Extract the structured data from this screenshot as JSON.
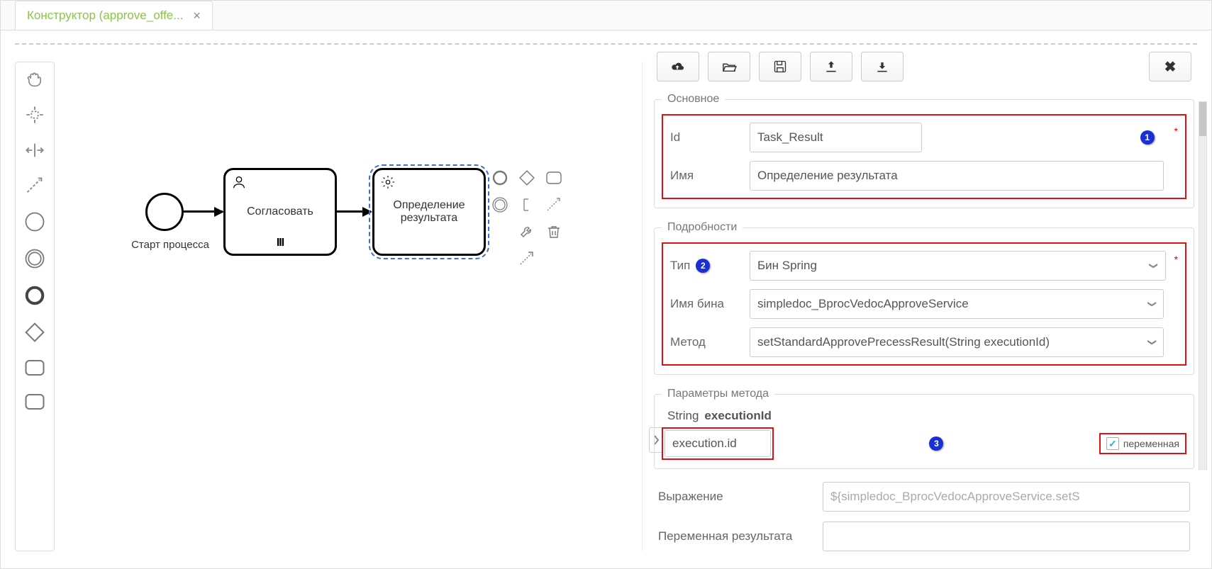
{
  "tab": {
    "title": "Конструктор (approve_offe...",
    "close_glyph": "×"
  },
  "palette": {
    "tools": [
      "hand",
      "lasso",
      "space",
      "connect",
      "start-event",
      "intermediate-event",
      "end-event",
      "gateway",
      "task",
      "sub-process"
    ]
  },
  "canvas": {
    "start_label": "Старт процесса",
    "user_task_label": "Согласовать",
    "service_task_line1": "Определение",
    "service_task_line2": "результата"
  },
  "toolbar": {
    "buttons": [
      "cloud-upload",
      "open",
      "save",
      "export",
      "import"
    ],
    "close": "✕"
  },
  "panel": {
    "section_main": "Основное",
    "section_details": "Подробности",
    "section_params": "Параметры метода",
    "id_label": "Id",
    "id_value": "Task_Result",
    "name_label": "Имя",
    "name_value": "Определение результата",
    "type_label": "Тип",
    "type_value": "Бин Spring",
    "bean_label": "Имя бина",
    "bean_value": "simpledoc_BprocVedocApproveService",
    "method_label": "Метод",
    "method_value": "setStandardApprovePrecessResult(String executionId)",
    "param_type": "String",
    "param_name": "executionId",
    "param_value": "execution.id",
    "param_checkbox_label": "переменная",
    "expression_label": "Выражение",
    "expression_value": "${simpledoc_BprocVedocApproveService.setS",
    "result_var_label": "Переменная результата",
    "result_var_value": ""
  },
  "annotations": {
    "n1": "1",
    "n2": "2",
    "n3": "3"
  }
}
